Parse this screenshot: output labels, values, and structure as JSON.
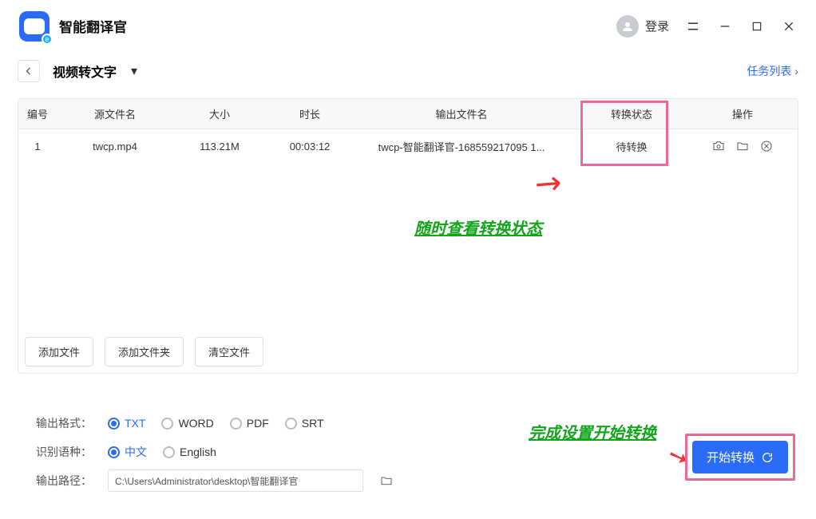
{
  "app": {
    "title": "智能翻译官",
    "login": "登录"
  },
  "header": {
    "pageTitle": "视频转文字",
    "taskList": "任务列表"
  },
  "table": {
    "head": {
      "idx": "编号",
      "src": "源文件名",
      "size": "大小",
      "dur": "时长",
      "out": "输出文件名",
      "stat": "转换状态",
      "ops": "操作"
    },
    "rows": [
      {
        "idx": "1",
        "src": "twcp.mp4",
        "size": "113.21M",
        "dur": "00:03:12",
        "out": "twcp-智能翻译官-168559217095 1...",
        "stat": "待转换"
      }
    ]
  },
  "buttons": {
    "addFile": "添加文件",
    "addFolder": "添加文件夹",
    "clear": "清空文件",
    "start": "开始转换"
  },
  "settings": {
    "outFmtLabel": "输出格式：",
    "fmts": {
      "txt": "TXT",
      "word": "WORD",
      "pdf": "PDF",
      "srt": "SRT"
    },
    "langLabel": "识别语种：",
    "langs": {
      "zh": "中文",
      "en": "English"
    },
    "outPathLabel": "输出路径：",
    "outPath": "C:\\Users\\Administrator\\desktop\\智能翻译官"
  },
  "annotations": {
    "a1": "随时查看转换状态",
    "a2": "完成设置开始转换"
  }
}
